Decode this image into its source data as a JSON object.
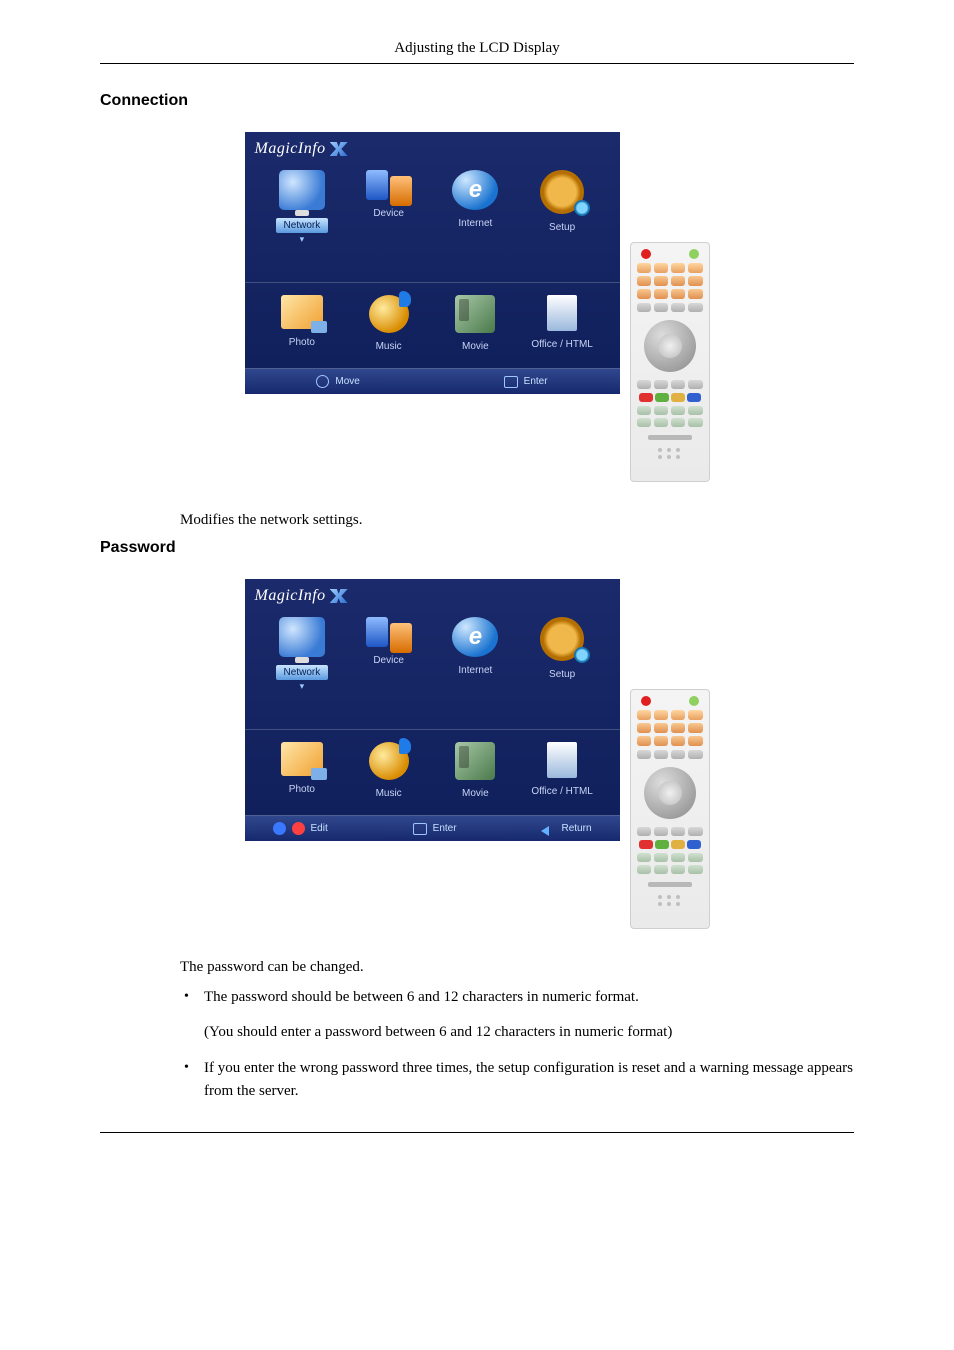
{
  "header": {
    "title": "Adjusting the LCD Display"
  },
  "section1": {
    "title": "Connection",
    "description": "Modifies the network settings."
  },
  "section2": {
    "title": "Password",
    "intro": "The password can be changed.",
    "bullets": [
      {
        "text": "The password should be between 6 and 12 characters in numeric format.",
        "note": "(You should enter a password between 6 and 12 characters in numeric format)"
      },
      {
        "text": "If you enter the wrong password three times, the setup configuration is reset and a warning message appears from the server."
      }
    ]
  },
  "osd": {
    "logo": "MagicInfo",
    "topMenu": [
      {
        "label": "Network",
        "selected": true
      },
      {
        "label": "Device",
        "selected": false
      },
      {
        "label": "Internet",
        "selected": false
      },
      {
        "label": "Setup",
        "selected": false
      }
    ],
    "bottomMenu": [
      {
        "label": "Photo"
      },
      {
        "label": "Music"
      },
      {
        "label": "Movie"
      },
      {
        "label": "Office / HTML"
      }
    ],
    "hintsA": {
      "left": "Move",
      "right": "Enter",
      "icon_left": "◇",
      "icon_right": "▢"
    },
    "hintsB": {
      "left": "Edit",
      "mid": "Enter",
      "right": "Return"
    }
  }
}
